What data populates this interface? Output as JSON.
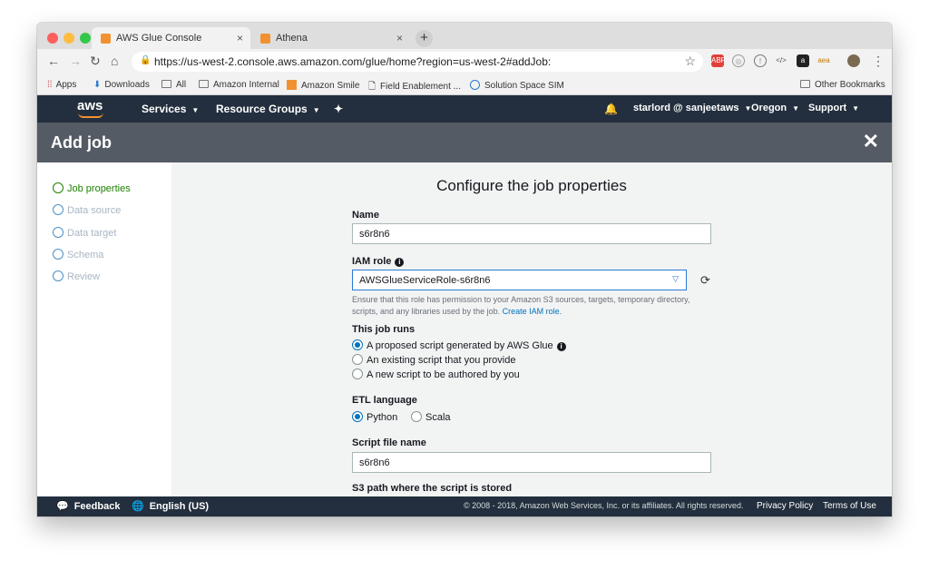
{
  "browser": {
    "tabs": [
      {
        "title": "AWS Glue Console",
        "close": "×"
      },
      {
        "title": "Athena",
        "close": "×"
      }
    ],
    "new_tab": "+",
    "url": "https://us-west-2.console.aws.amazon.com/glue/home?region=us-west-2#addJob:",
    "bookmarks": [
      "Apps",
      "Downloads",
      "All",
      "Amazon Internal",
      "Amazon Smile",
      "Field Enablement ...",
      "Solution Space SIM"
    ],
    "other_bookmarks": "Other Bookmarks"
  },
  "nav": {
    "logo": "aws",
    "services": "Services",
    "resource_groups": "Resource Groups",
    "user": "starlord @ sanjeetaws",
    "region": "Oregon",
    "support": "Support"
  },
  "page": {
    "title": "Add job",
    "close": "✕"
  },
  "steps": [
    "Job properties",
    "Data source",
    "Data target",
    "Schema",
    "Review"
  ],
  "form": {
    "heading": "Configure the job properties",
    "name_label": "Name",
    "name_value": "s6r8n6",
    "iam_label": "IAM role",
    "iam_value": "AWSGlueServiceRole-s6r8n6",
    "iam_help": "Ensure that this role has permission to your Amazon S3 sources, targets, temporary directory, scripts, and any libraries used by the job.",
    "iam_help_link": "Create IAM role.",
    "runs_label": "This job runs",
    "runs_options": [
      "A proposed script generated by AWS Glue",
      "An existing script that you provide",
      "A new script to be authored by you"
    ],
    "etl_label": "ETL language",
    "etl_options": [
      "Python",
      "Scala"
    ],
    "script_label": "Script file name",
    "script_value": "s6r8n6",
    "s3_label": "S3 path where the script is stored"
  },
  "footer": {
    "feedback": "Feedback",
    "language": "English (US)",
    "copyright": "© 2008 - 2018, Amazon Web Services, Inc. or its affiliates. All rights reserved.",
    "privacy": "Privacy Policy",
    "terms": "Terms of Use"
  },
  "colors": {
    "aws_nav": "#232f3e",
    "header": "#545b64",
    "accent_blue": "#0073bb",
    "step_active": "#1d8102",
    "aws_orange": "#f29131"
  }
}
